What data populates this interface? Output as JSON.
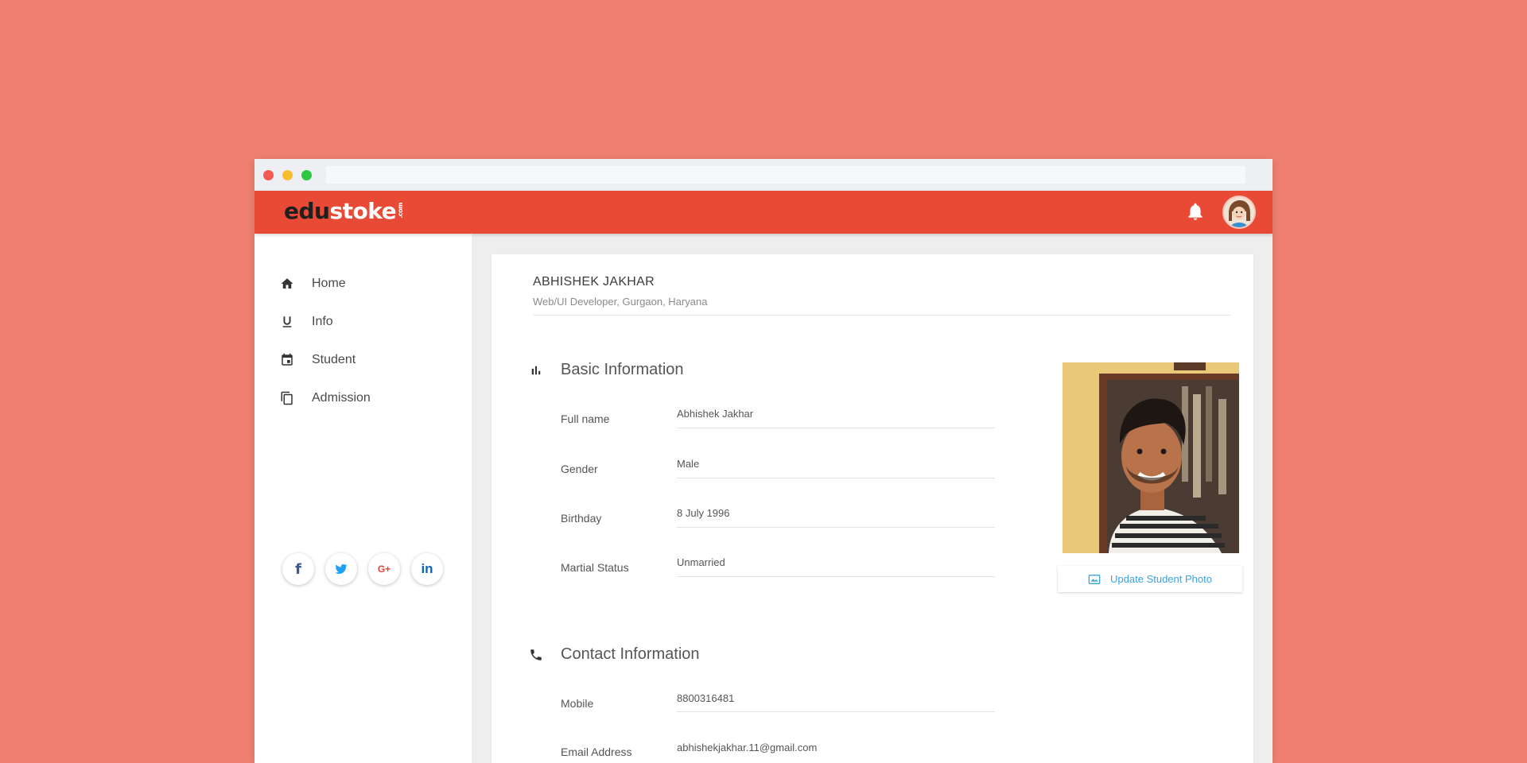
{
  "brand": {
    "edu": "edu",
    "stoke": "stoke",
    "com": ".com"
  },
  "colors": {
    "page_bg": "#EF8070",
    "appbar": "#E84A35",
    "link": "#3AA3E3"
  },
  "sidebar": {
    "items": [
      {
        "label": "Home",
        "icon": "home-icon"
      },
      {
        "label": "Info",
        "icon": "underline-icon"
      },
      {
        "label": "Student",
        "icon": "calendar-icon"
      },
      {
        "label": "Admission",
        "icon": "copy-icon"
      }
    ],
    "social": [
      {
        "label": "f",
        "icon": "facebook-icon"
      },
      {
        "label": "t",
        "icon": "twitter-icon"
      },
      {
        "label": "G+",
        "icon": "google-plus-icon"
      },
      {
        "label": "in",
        "icon": "linkedin-icon"
      }
    ]
  },
  "profile": {
    "name": "ABHISHEK JAKHAR",
    "role": "Web/UI Developer, Gurgaon, Haryana"
  },
  "basic": {
    "title": "Basic Information",
    "fields": [
      {
        "label": "Full name",
        "value": "Abhishek Jakhar"
      },
      {
        "label": "Gender",
        "value": "Male"
      },
      {
        "label": "Birthday",
        "value": "8 July 1996"
      },
      {
        "label": "Martial Status",
        "value": "Unmarried"
      }
    ]
  },
  "contact": {
    "title": "Contact Information",
    "fields": [
      {
        "label": "Mobile",
        "value": "8800316481"
      },
      {
        "label": "Email Address",
        "value": "abhishekjakhar.11@gmail.com"
      }
    ]
  },
  "photo": {
    "button_label": "Update Student Photo"
  }
}
